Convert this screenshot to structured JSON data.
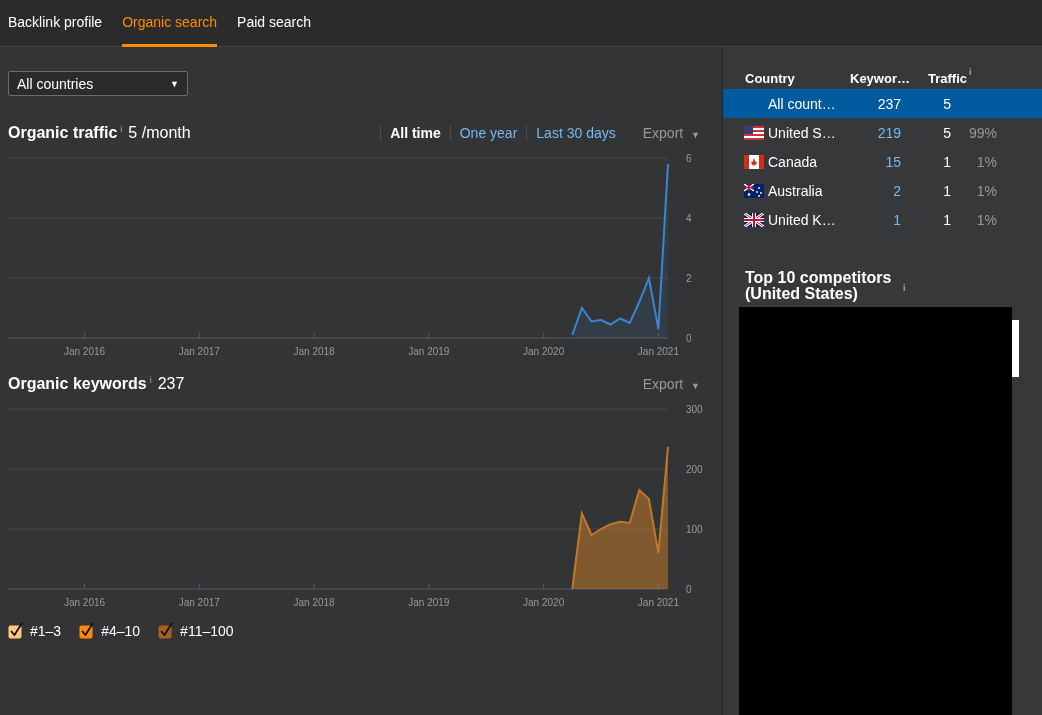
{
  "tabs": [
    {
      "label": "Backlink profile",
      "selected": false
    },
    {
      "label": "Organic search",
      "selected": true
    },
    {
      "label": "Paid search",
      "selected": false
    }
  ],
  "country_select": {
    "value": "All countries",
    "caret": "▼"
  },
  "traffic": {
    "title": "Organic traffic",
    "info": "i",
    "value": "5 /month",
    "ranges": [
      {
        "label": "All time",
        "selected": true
      },
      {
        "label": "One year",
        "selected": false
      },
      {
        "label": "Last 30 days",
        "selected": false
      }
    ],
    "export": "Export",
    "export_caret": "▼",
    "chart_data": {
      "type": "area",
      "ylim": [
        0,
        6
      ],
      "yticks": [
        0,
        2,
        4,
        6
      ],
      "categories": [
        null,
        null,
        null,
        null,
        null,
        null,
        null,
        null,
        "Jan 2016",
        null,
        null,
        null,
        null,
        null,
        null,
        null,
        null,
        null,
        null,
        null,
        "Jan 2017",
        null,
        null,
        null,
        null,
        null,
        null,
        null,
        null,
        null,
        null,
        null,
        "Jan 2018",
        null,
        null,
        null,
        null,
        null,
        null,
        null,
        null,
        null,
        null,
        null,
        "Jan 2019",
        null,
        null,
        null,
        null,
        null,
        null,
        null,
        null,
        null,
        null,
        null,
        "Jan 2020",
        null,
        null,
        null,
        null,
        null,
        null,
        null,
        null,
        null,
        null,
        null,
        "Jan 2021",
        null
      ],
      "series": [
        {
          "color": "#3a86cf",
          "values": [
            null,
            null,
            null,
            null,
            null,
            null,
            null,
            null,
            null,
            null,
            null,
            null,
            null,
            null,
            null,
            null,
            null,
            null,
            null,
            null,
            null,
            null,
            null,
            null,
            null,
            null,
            null,
            null,
            null,
            null,
            null,
            null,
            null,
            null,
            null,
            null,
            null,
            null,
            null,
            null,
            null,
            null,
            null,
            null,
            null,
            null,
            null,
            null,
            null,
            null,
            null,
            null,
            null,
            null,
            null,
            null,
            null,
            null,
            null,
            0.1,
            1.0,
            0.55,
            0.6,
            0.45,
            0.65,
            0.5,
            1.2,
            2.0,
            0.3,
            5.8
          ]
        }
      ]
    }
  },
  "keywords": {
    "title": "Organic keywords",
    "info": "i",
    "value": "237",
    "export": "Export",
    "export_caret": "▼",
    "chart_data": {
      "type": "area",
      "ylim": [
        0,
        300
      ],
      "yticks": [
        0,
        100,
        200,
        300
      ],
      "categories": [
        null,
        null,
        null,
        null,
        null,
        null,
        null,
        null,
        "Jan 2016",
        null,
        null,
        null,
        null,
        null,
        null,
        null,
        null,
        null,
        null,
        null,
        "Jan 2017",
        null,
        null,
        null,
        null,
        null,
        null,
        null,
        null,
        null,
        null,
        null,
        "Jan 2018",
        null,
        null,
        null,
        null,
        null,
        null,
        null,
        null,
        null,
        null,
        null,
        "Jan 2019",
        null,
        null,
        null,
        null,
        null,
        null,
        null,
        null,
        null,
        null,
        null,
        "Jan 2020",
        null,
        null,
        null,
        null,
        null,
        null,
        null,
        null,
        null,
        null,
        null,
        "Jan 2021",
        null
      ],
      "series": [
        {
          "color": "#c0782a",
          "values": [
            null,
            null,
            null,
            null,
            null,
            null,
            null,
            null,
            null,
            null,
            null,
            null,
            null,
            null,
            null,
            null,
            null,
            null,
            null,
            null,
            null,
            null,
            null,
            null,
            null,
            null,
            null,
            null,
            null,
            null,
            null,
            null,
            null,
            null,
            null,
            null,
            null,
            null,
            null,
            null,
            null,
            null,
            null,
            null,
            null,
            null,
            null,
            null,
            null,
            null,
            null,
            null,
            null,
            null,
            null,
            null,
            null,
            null,
            null,
            0,
            126,
            90,
            100,
            108,
            112,
            110,
            165,
            150,
            60,
            237
          ]
        }
      ]
    },
    "legend": [
      {
        "label": "#1–3",
        "color": "#ffc880",
        "checked": true
      },
      {
        "label": "#4–10",
        "color": "#ff8c00",
        "checked": true
      },
      {
        "label": "#11–100",
        "color": "#a8601c",
        "checked": true
      }
    ]
  },
  "countries": {
    "columns": [
      "Country",
      "Keywor…",
      "Traffic"
    ],
    "traffic_info": "i",
    "rows": [
      {
        "kind": "all",
        "country": "All count…",
        "keywords": "237",
        "traffic": "5",
        "selected": true
      },
      {
        "kind": "us",
        "country": "United S…",
        "keywords": "219",
        "traffic": "5",
        "share": "99%",
        "selected": false
      },
      {
        "kind": "ca",
        "country": "Canada",
        "keywords": "15",
        "traffic": "1",
        "share": "1%",
        "selected": false
      },
      {
        "kind": "au",
        "country": "Australia",
        "keywords": "2",
        "traffic": "1",
        "share": "1%",
        "selected": false
      },
      {
        "kind": "gb",
        "country": "United K…",
        "keywords": "1",
        "traffic": "1",
        "share": "1%",
        "selected": false
      }
    ]
  },
  "competitors": {
    "title": "Top 10 competitors (United States)",
    "info": "i"
  }
}
